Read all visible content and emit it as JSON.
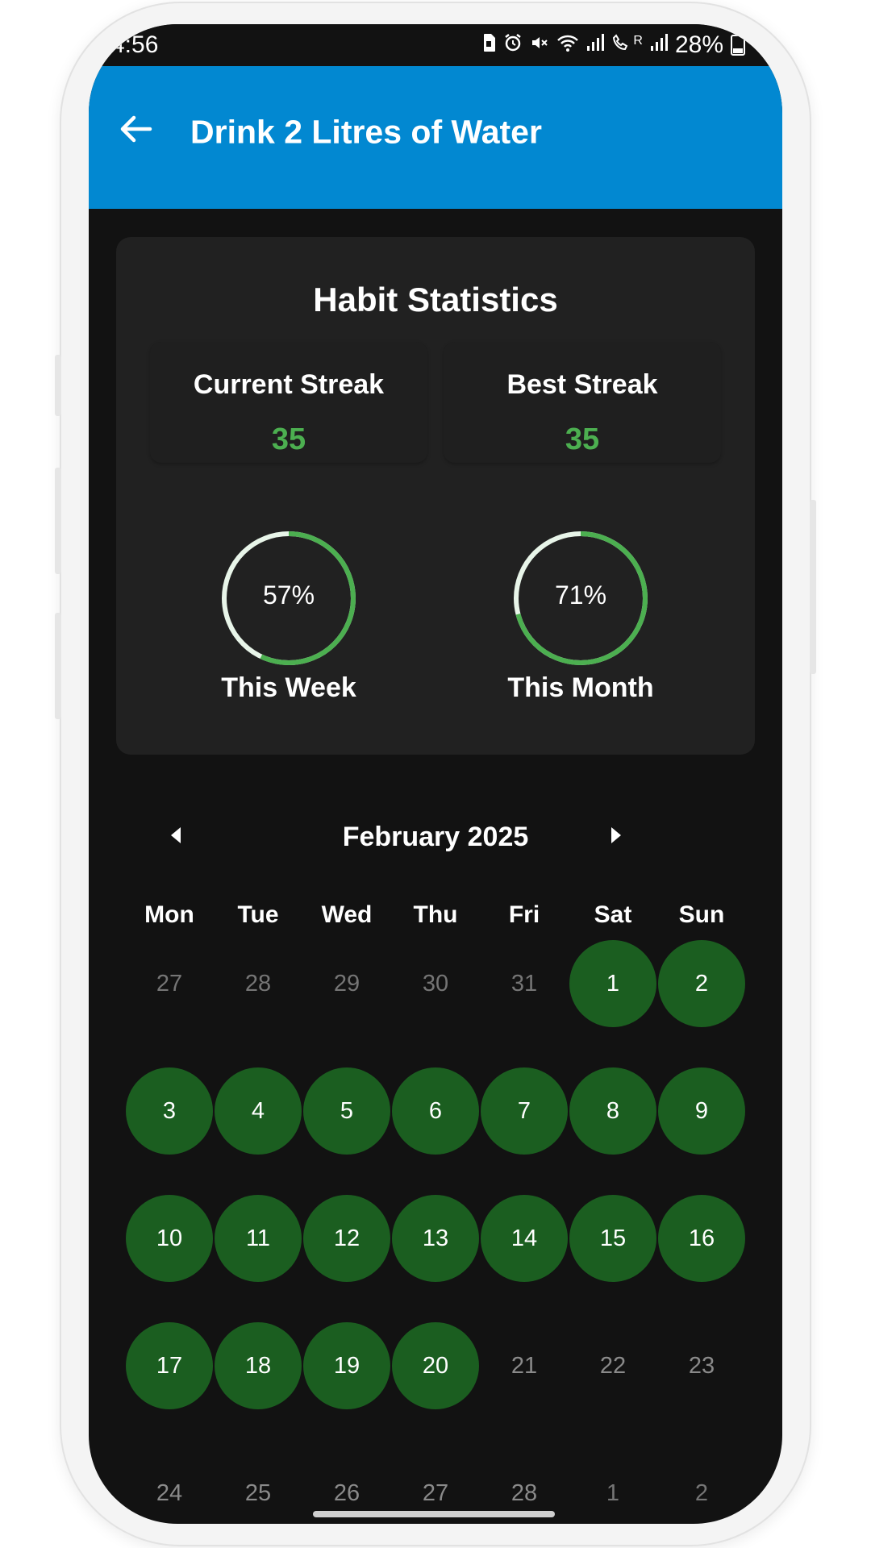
{
  "status_bar": {
    "time": "4:56",
    "icons": [
      "sim-icon",
      "alarm-icon",
      "mute-icon",
      "wifi-icon",
      "signal-icon",
      "volte-icon",
      "signal-2-icon"
    ],
    "volte_label": "R",
    "battery": "28%"
  },
  "app_bar": {
    "title": "Drink 2 Litres of Water",
    "back_icon": "arrow-left-icon",
    "color": "#0288d1"
  },
  "stats": {
    "title": "Habit Statistics",
    "current_streak": {
      "label": "Current Streak",
      "value": "35"
    },
    "best_streak": {
      "label": "Best Streak",
      "value": "35"
    },
    "this_week": {
      "label": "This Week",
      "percent_text": "57%",
      "percent": 57
    },
    "this_month": {
      "label": "This Month",
      "percent_text": "71%",
      "percent": 71
    },
    "accent_color": "#4caf50"
  },
  "calendar": {
    "month_label": "February 2025",
    "prev_icon": "caret-left-icon",
    "next_icon": "caret-right-icon",
    "weekdays": [
      "Mon",
      "Tue",
      "Wed",
      "Thu",
      "Fri",
      "Sat",
      "Sun"
    ],
    "done_color": "#1b5e20",
    "weeks": [
      [
        {
          "d": "27",
          "s": "muted"
        },
        {
          "d": "28",
          "s": "muted"
        },
        {
          "d": "29",
          "s": "muted"
        },
        {
          "d": "30",
          "s": "muted"
        },
        {
          "d": "31",
          "s": "muted"
        },
        {
          "d": "1",
          "s": "done"
        },
        {
          "d": "2",
          "s": "done"
        }
      ],
      [
        {
          "d": "3",
          "s": "done"
        },
        {
          "d": "4",
          "s": "done"
        },
        {
          "d": "5",
          "s": "done"
        },
        {
          "d": "6",
          "s": "done"
        },
        {
          "d": "7",
          "s": "done"
        },
        {
          "d": "8",
          "s": "done"
        },
        {
          "d": "9",
          "s": "done"
        }
      ],
      [
        {
          "d": "10",
          "s": "done"
        },
        {
          "d": "11",
          "s": "done"
        },
        {
          "d": "12",
          "s": "done"
        },
        {
          "d": "13",
          "s": "done"
        },
        {
          "d": "14",
          "s": "done"
        },
        {
          "d": "15",
          "s": "done"
        },
        {
          "d": "16",
          "s": "done"
        }
      ],
      [
        {
          "d": "17",
          "s": "done"
        },
        {
          "d": "18",
          "s": "done"
        },
        {
          "d": "19",
          "s": "done"
        },
        {
          "d": "20",
          "s": "done"
        },
        {
          "d": "21",
          "s": "plain"
        },
        {
          "d": "22",
          "s": "plain"
        },
        {
          "d": "23",
          "s": "plain"
        }
      ],
      [
        {
          "d": "24",
          "s": "plain"
        },
        {
          "d": "25",
          "s": "plain"
        },
        {
          "d": "26",
          "s": "plain"
        },
        {
          "d": "27",
          "s": "plain"
        },
        {
          "d": "28",
          "s": "plain"
        },
        {
          "d": "1",
          "s": "muted"
        },
        {
          "d": "2",
          "s": "muted"
        }
      ]
    ]
  }
}
